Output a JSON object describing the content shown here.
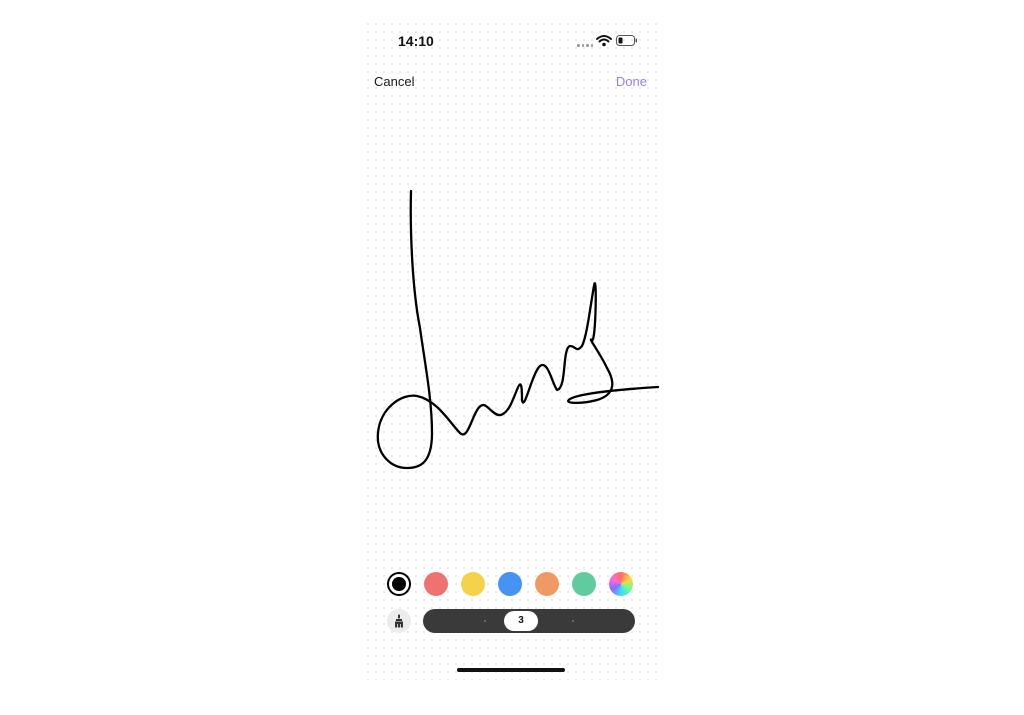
{
  "status_bar": {
    "time": "14:10"
  },
  "nav": {
    "cancel_label": "Cancel",
    "done_label": "Done"
  },
  "palette": {
    "colors": [
      "#000000",
      "#ef7272",
      "#f4d24c",
      "#4792f3",
      "#ef9a64",
      "#5fcb9f",
      "rainbow"
    ],
    "selected_index": 0
  },
  "brush": {
    "icon": "brush-icon"
  },
  "stroke_width": {
    "value": "3"
  },
  "signature": {
    "stroke_color": "#000000"
  }
}
